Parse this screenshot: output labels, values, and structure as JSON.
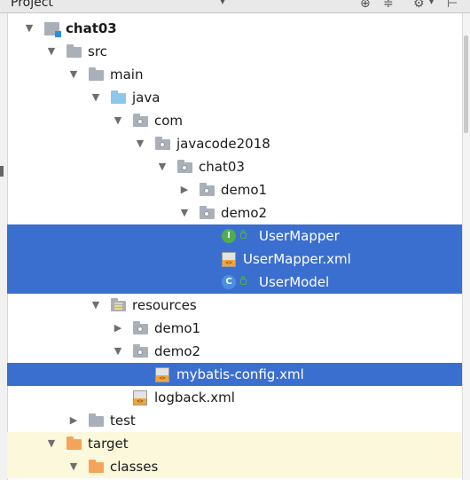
{
  "toolbar": {
    "title": "Project",
    "caret": "▾",
    "icons": [
      "locate-icon",
      "collapse-all-icon",
      "gear-icon",
      "hide-icon"
    ]
  },
  "tree": [
    {
      "label": "chat03",
      "kind": "module",
      "arrow": "▼",
      "bold": true
    },
    {
      "label": "src",
      "kind": "folder",
      "arrow": "▼"
    },
    {
      "label": "main",
      "kind": "folder",
      "arrow": "▼"
    },
    {
      "label": "java",
      "kind": "source-folder",
      "arrow": "▼"
    },
    {
      "label": "com",
      "kind": "package",
      "arrow": "▼"
    },
    {
      "label": "javacode2018",
      "kind": "package",
      "arrow": "▼"
    },
    {
      "label": "chat03",
      "kind": "package",
      "arrow": "▼"
    },
    {
      "label": "demo1",
      "kind": "package",
      "arrow": "▶"
    },
    {
      "label": "demo2",
      "kind": "package",
      "arrow": "▼"
    },
    {
      "label": "UserMapper",
      "kind": "interface",
      "badge": "I",
      "selected": true
    },
    {
      "label": "UserMapper.xml",
      "kind": "xml",
      "selected": true
    },
    {
      "label": "UserModel",
      "kind": "class",
      "badge": "C",
      "selected": true
    },
    {
      "label": "resources",
      "kind": "resources-folder",
      "arrow": "▼"
    },
    {
      "label": "demo1",
      "kind": "package",
      "arrow": "▶"
    },
    {
      "label": "demo2",
      "kind": "package",
      "arrow": "▼"
    },
    {
      "label": "mybatis-config.xml",
      "kind": "xml",
      "selected": true
    },
    {
      "label": "logback.xml",
      "kind": "xml"
    },
    {
      "label": "test",
      "kind": "folder",
      "arrow": "▶"
    },
    {
      "label": "target",
      "kind": "excluded-folder",
      "arrow": "▼"
    },
    {
      "label": "classes",
      "kind": "excluded-folder",
      "arrow": "▼"
    }
  ],
  "colors": {
    "selection": "#3b6fcf",
    "excluded_background": "#fbf8dc",
    "folder": "#a9b0b8",
    "source_folder": "#8cc8ec",
    "excluded_folder": "#f5a35a"
  }
}
